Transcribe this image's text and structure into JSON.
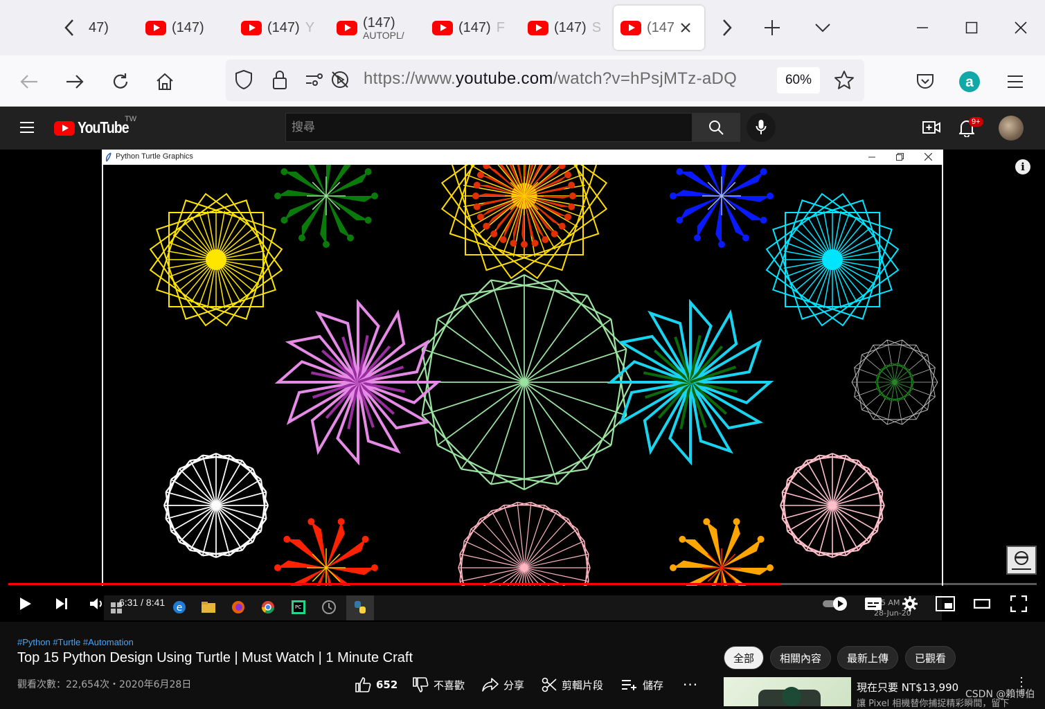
{
  "browser": {
    "tabs": [
      {
        "label": "47)",
        "partial": ""
      },
      {
        "label": "(147)",
        "partial": ""
      },
      {
        "label": "(147)",
        "partial": "Y"
      },
      {
        "label": "(147)",
        "partial": "",
        "sub": "AUTOPL/"
      },
      {
        "label": "(147)",
        "partial": "F"
      },
      {
        "label": "(147)",
        "partial": "S"
      },
      {
        "label": "(147",
        "partial": ""
      }
    ],
    "url_prefix": "https://www.",
    "url_domain": "youtube.com",
    "url_path": "/watch?v=hPsjMTz-aDQ",
    "zoom": "60%",
    "colors": {
      "chrome_bg": "#f0f0f4",
      "extension_accent": "#12a8a8"
    }
  },
  "youtube": {
    "logo_text": "YouTube",
    "region": "TW",
    "search_placeholder": "搜尋",
    "notification_badge": "9+",
    "colors": {
      "brand_red": "#ff0000",
      "link_blue": "#3ea6ff"
    }
  },
  "player": {
    "window_title": "Python Turtle Graphics",
    "current_time": "6:31 / 8:41",
    "progress_fraction": 0.751,
    "taskbar_clock": "55 AM",
    "taskbar_date": "28-Jun-20"
  },
  "video": {
    "hashtags": "#Python #Turtle #Automation",
    "title": "Top 15 Python Design Using Turtle | Must Watch | 1 Minute Craft",
    "meta": "觀看次數：22,654次・2020年6月28日",
    "likes": "652",
    "dislike_label": "不喜歡",
    "share_label": "分享",
    "clip_label": "剪輯片段",
    "save_label": "儲存",
    "more_label": "..."
  },
  "filters": [
    "全部",
    "相關內容",
    "最新上傳",
    "已觀看"
  ],
  "ad": {
    "title": "現在只要 NT$13,990",
    "subtitle": "讓 Pixel 相機替你捕捉精彩瞬間，留下"
  },
  "watermark": "CSDN @賴博伯"
}
